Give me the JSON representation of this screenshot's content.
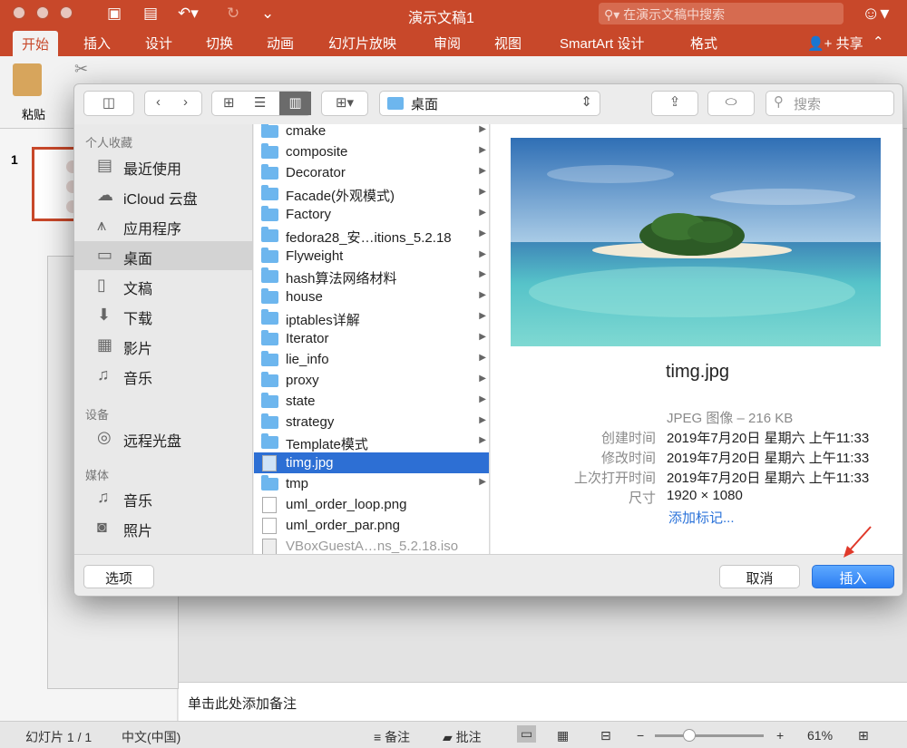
{
  "window": {
    "title": "演示文稿1",
    "search_placeholder": "在演示文稿中搜索",
    "share": "共享"
  },
  "ribbon": {
    "tabs": [
      "开始",
      "插入",
      "设计",
      "切换",
      "动画",
      "幻灯片放映",
      "审阅",
      "视图"
    ],
    "context_tabs": [
      "SmartArt 设计",
      "格式"
    ],
    "paste_label": "粘贴"
  },
  "slide_pane": {
    "slide_number": "1"
  },
  "dialog": {
    "location": "桌面",
    "search_label": "搜索",
    "sidebar": {
      "sections": [
        {
          "title": "个人收藏",
          "items": [
            "最近使用",
            "iCloud 云盘",
            "应用程序",
            "桌面",
            "文稿",
            "下载",
            "影片",
            "音乐"
          ]
        },
        {
          "title": "设备",
          "items": [
            "远程光盘"
          ]
        },
        {
          "title": "媒体",
          "items": [
            "音乐",
            "照片"
          ]
        }
      ]
    },
    "files": [
      "cmake",
      "composite",
      "Decorator",
      "Facade(外观模式)",
      "Factory",
      "fedora28_安…itions_5.2.18",
      "Flyweight",
      "hash算法网络材料",
      "house",
      "iptables详解",
      "Iterator",
      "lie_info",
      "proxy",
      "state",
      "strategy",
      "Template模式",
      "timg.jpg",
      "tmp",
      "uml_order_loop.png",
      "uml_order_par.png",
      "VBoxGuestA…ns_5.2.18.iso"
    ],
    "selected_file": "timg.jpg",
    "preview": {
      "name": "timg.jpg",
      "kind": "JPEG 图像 – 216 KB",
      "created_label": "创建时间",
      "created": "2019年7月20日 星期六 上午11:33",
      "modified_label": "修改时间",
      "modified": "2019年7月20日 星期六 上午11:33",
      "opened_label": "上次打开时间",
      "opened": "2019年7月20日 星期六 上午11:33",
      "size_label": "尺寸",
      "size": "1920 × 1080",
      "add_tags": "添加标记..."
    },
    "options_button": "选项",
    "cancel_button": "取消",
    "insert_button": "插入"
  },
  "notes_placeholder": "单击此处添加备注",
  "status": {
    "slide": "幻灯片 1 / 1",
    "language": "中文(中国)",
    "notes": "备注",
    "comments": "批注",
    "zoom": "61%"
  },
  "colors": {
    "accent": "#c8482a",
    "selection": "#2d6fd4",
    "primary_button": "#2b7df2"
  }
}
